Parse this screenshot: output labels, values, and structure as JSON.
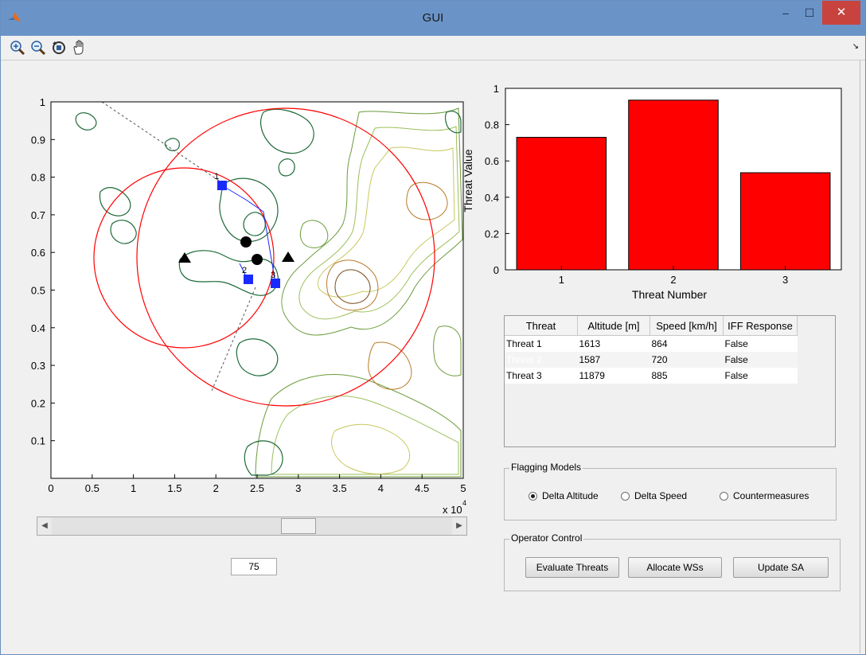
{
  "window": {
    "title": "GUI",
    "minimize": "–",
    "maximize": "☐",
    "close": "✕"
  },
  "toolbar": {
    "tools": [
      "zoom-in-icon",
      "zoom-out-icon",
      "rotate-icon",
      "pan-icon"
    ]
  },
  "map_axes": {
    "y_ticks": [
      "1",
      "0.9",
      "0.8",
      "0.7",
      "0.6",
      "0.5",
      "0.4",
      "0.3",
      "0.2",
      "0.1"
    ],
    "x_ticks": [
      "0",
      "0.5",
      "1",
      "1.5",
      "2",
      "2.5",
      "3",
      "3.5",
      "4",
      "4.5",
      "5"
    ],
    "x_scale_label": "x 10",
    "x_scale_exp": "4",
    "point_labels": [
      "1",
      "2",
      "3"
    ]
  },
  "slider": {
    "value": 75,
    "edit_value": "75"
  },
  "chart_data": {
    "type": "bar",
    "categories": [
      "1",
      "2",
      "3"
    ],
    "values": [
      0.73,
      0.935,
      0.535
    ],
    "xlabel": "Threat Number",
    "ylabel": "Threat Value",
    "ylim": [
      0,
      1
    ],
    "y_ticks": [
      "0",
      "0.2",
      "0.4",
      "0.6",
      "0.8",
      "1"
    ],
    "bar_color": "#ff0000"
  },
  "threat_table": {
    "headers": [
      "Threat",
      "Altitude [m]",
      "Speed [km/h]",
      "IFF Response"
    ],
    "rows": [
      [
        "Threat 1",
        "1613",
        "864",
        "False"
      ],
      [
        "Threat 2",
        "1587",
        "720",
        "False"
      ],
      [
        "Threat 3",
        "11879",
        "885",
        "False"
      ]
    ],
    "selected_cell": "Threat 2"
  },
  "flagging": {
    "title": "Flagging Models",
    "options": [
      "Delta Altitude",
      "Delta Speed",
      "Countermeasures"
    ],
    "selected": "Delta Altitude"
  },
  "operator": {
    "title": "Operator Control",
    "buttons": [
      "Evaluate Threats",
      "Allocate WSs",
      "Update SA"
    ]
  }
}
